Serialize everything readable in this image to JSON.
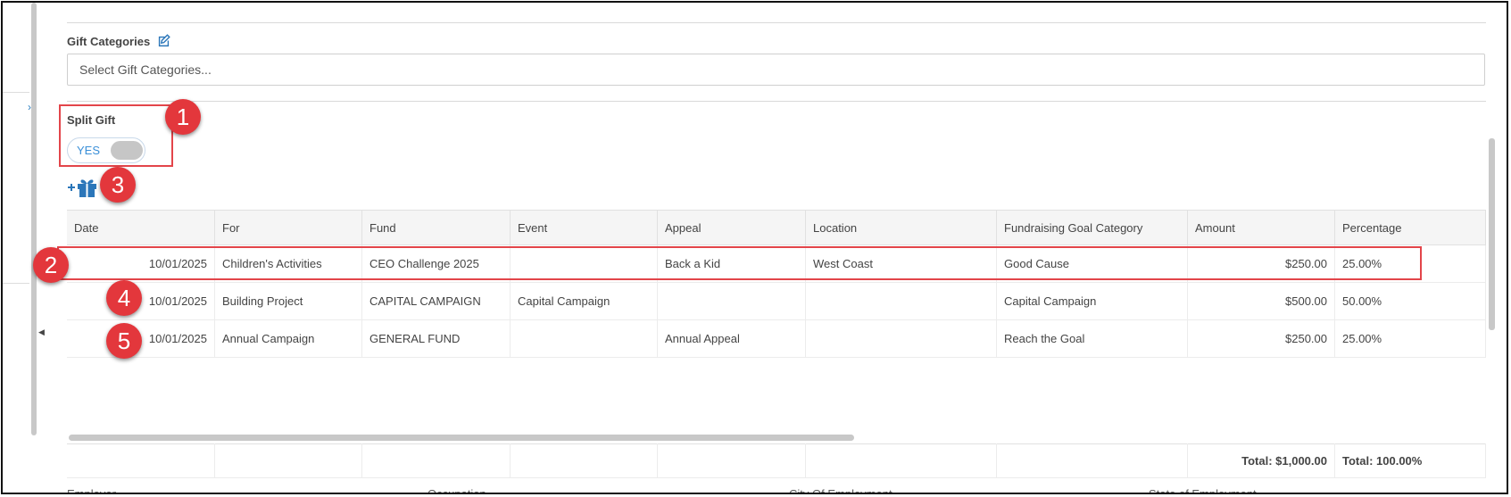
{
  "gift_categories": {
    "label": "Gift Categories",
    "placeholder": "Select Gift Categories..."
  },
  "split_gift": {
    "label": "Split Gift",
    "toggle_label": "YES"
  },
  "table": {
    "headers": [
      "Date",
      "For",
      "Fund",
      "Event",
      "Appeal",
      "Location",
      "Fundraising Goal Category",
      "Amount",
      "Percentage"
    ],
    "rows": [
      [
        "10/01/2025",
        "Children's Activities",
        "CEO Challenge 2025",
        "",
        "Back a Kid",
        "West Coast",
        "Good Cause",
        "$250.00",
        "25.00%"
      ],
      [
        "10/01/2025",
        "Building Project",
        "CAPITAL CAMPAIGN",
        "Capital Campaign",
        "",
        "",
        "Capital Campaign",
        "$500.00",
        "50.00%"
      ],
      [
        "10/01/2025",
        "Annual Campaign",
        "GENERAL FUND",
        "",
        "Annual Appeal",
        "",
        "Reach the Goal",
        "$250.00",
        "25.00%"
      ]
    ],
    "total_amount": "Total: $1,000.00",
    "total_percentage": "Total: 100.00%"
  },
  "bottom_fields": [
    "Employer",
    "Occupation",
    "City Of Employment",
    "State of Employment"
  ],
  "annotations": [
    "1",
    "2",
    "3",
    "4",
    "5"
  ],
  "colors": {
    "accent": "#2b76b9",
    "annotation": "#e3373c"
  },
  "icons": [
    "edit-icon",
    "add-gift-icon",
    "chevron-right-icon",
    "collapse-left-icon"
  ]
}
